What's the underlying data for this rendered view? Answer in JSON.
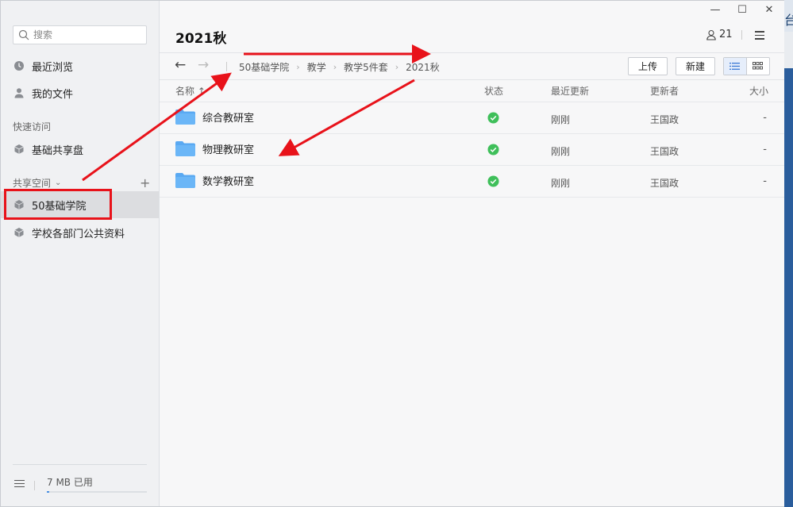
{
  "sidebar": {
    "search_placeholder": "搜索",
    "recent": "最近浏览",
    "my_files": "我的文件",
    "quick_access_label": "快速访问",
    "quick_items": [
      "基础共享盘"
    ],
    "shared_space_label": "共享空间",
    "shared_items": [
      "50基础学院",
      "学校各部门公共资料"
    ],
    "usage": "7 MB 已用",
    "usage_fraction": 0.02
  },
  "header": {
    "title": "2021秋",
    "member_count": "21"
  },
  "window_controls": {
    "minimize": "—",
    "maximize": "☐",
    "close": "✕"
  },
  "toolbar": {
    "back": "←",
    "forward": "→",
    "breadcrumb": [
      "50基础学院",
      "教学",
      "教学5件套",
      "2021秋"
    ],
    "upload": "上传",
    "new": "新建"
  },
  "table": {
    "columns": {
      "name": "名称 ↑",
      "status": "状态",
      "updated": "最近更新",
      "updater": "更新者",
      "size": "大小"
    },
    "rows": [
      {
        "name": "综合教研室",
        "updated": "刚刚",
        "updater": "王国政",
        "size": "-"
      },
      {
        "name": "物理教研室",
        "updated": "刚刚",
        "updater": "王国政",
        "size": "-"
      },
      {
        "name": "数学教研室",
        "updated": "刚刚",
        "updater": "王国政",
        "size": "-"
      }
    ]
  },
  "edge_glyph": "台",
  "colors": {
    "accent": "#4a90e2",
    "folder": "#5aa9f2",
    "status_ok": "#3fbf5a",
    "annotation": "#e8121a"
  }
}
